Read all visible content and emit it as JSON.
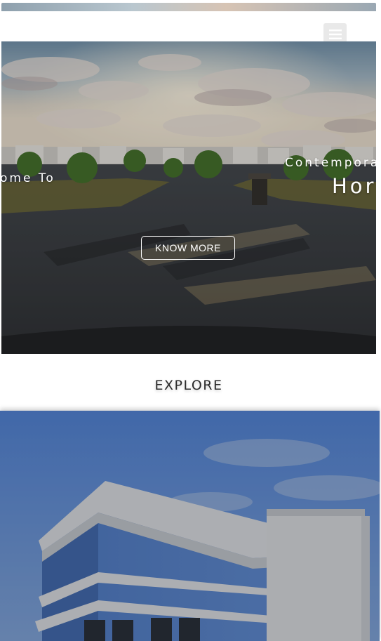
{
  "header": {
    "menu_icon": "hamburger-menu-icon"
  },
  "hero": {
    "welcome_text": "ome To",
    "contemporary_text": "Contempora",
    "homes_text": "Hor",
    "cta_label": "KNOW MORE"
  },
  "explore": {
    "heading": "EXPLORE"
  },
  "colors": {
    "sky_top": "#3d78d6",
    "building_blue": "#4d7ed0",
    "overlay": "#2b2b2b"
  }
}
